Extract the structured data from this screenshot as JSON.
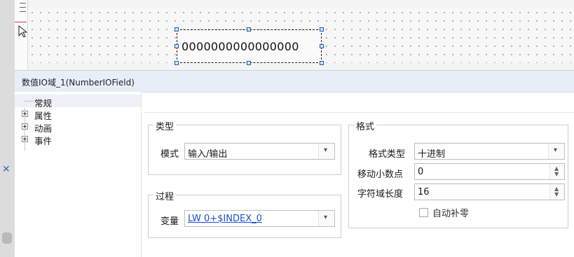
{
  "canvas": {
    "field_value": "0000000000000000"
  },
  "panel": {
    "title": "数值IO域_1(NumberIOField)"
  },
  "tree": {
    "items": [
      {
        "label": "常规",
        "expandable": false,
        "selected": true
      },
      {
        "label": "属性",
        "expandable": true
      },
      {
        "label": "动画",
        "expandable": true
      },
      {
        "label": "事件",
        "expandable": true
      }
    ]
  },
  "type_group": {
    "title": "类型",
    "mode_label": "模式",
    "mode_value": "输入/输出"
  },
  "process_group": {
    "title": "过程",
    "variable_label": "变量",
    "variable_value": "LW 0+$INDEX_0"
  },
  "format_group": {
    "title": "格式",
    "format_type_label": "格式类型",
    "format_type_value": "十进制",
    "decimal_shift_label": "移动小数点",
    "decimal_shift_value": "0",
    "field_length_label": "字符域长度",
    "field_length_value": "16",
    "auto_pad_label": "自动补零",
    "auto_pad_checked": false
  },
  "colors": {
    "variable_text": "#1a4fd0",
    "title_bar": "#e7eef8"
  }
}
